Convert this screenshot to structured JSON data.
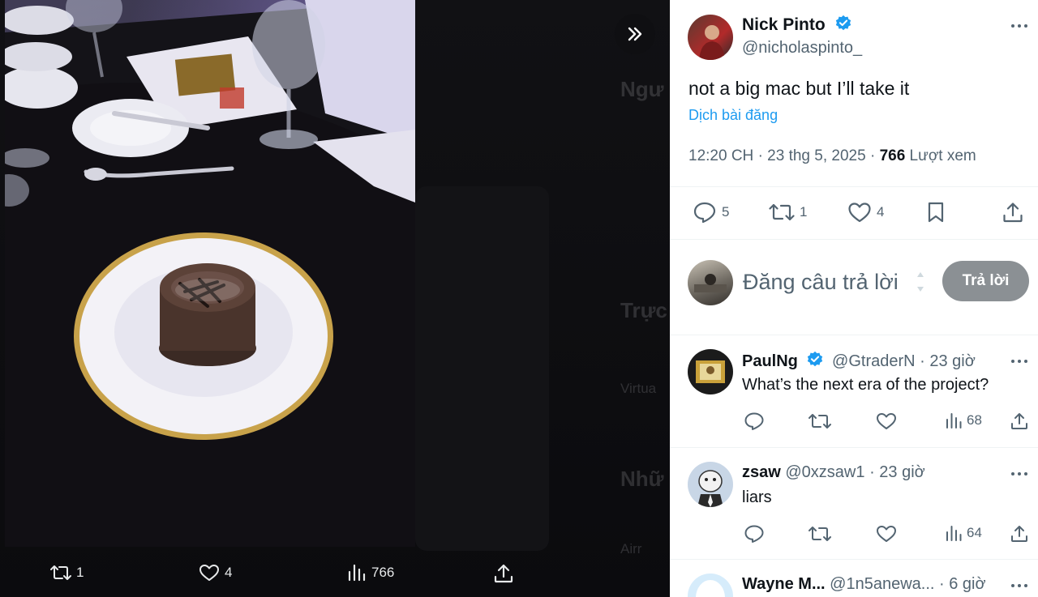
{
  "media": {
    "actions": [
      {
        "icon": "repost-icon",
        "count": "1"
      },
      {
        "icon": "heart-icon",
        "count": "4"
      },
      {
        "icon": "views-icon",
        "count": "766"
      },
      {
        "icon": "share-icon",
        "count": ""
      }
    ]
  },
  "tweet": {
    "name": "Nick Pinto",
    "handle": "@nicholaspinto_",
    "text": "not a big mac but I’ll take it",
    "translate": "Dịch bài đăng",
    "time": "12:20 CH",
    "date": "23 thg 5, 2025",
    "views_count": "766",
    "views_label": "Lượt xem",
    "replies": "5",
    "reposts": "1",
    "likes": "4"
  },
  "composer": {
    "placeholder": "Đăng câu trả lời",
    "button": "Trả lời"
  },
  "replies": [
    {
      "name": "PaulNg",
      "verified": true,
      "handle": "@GtraderN",
      "time": "23 giờ",
      "text": "What’s the next era of the project?",
      "views": "68"
    },
    {
      "name": "zsaw",
      "verified": false,
      "handle": "@0xzsaw1",
      "time": "23 giờ",
      "text": "liars",
      "views": "64"
    },
    {
      "name": "Wayne M...",
      "verified": false,
      "handle": "@1n5anewa...",
      "time": "6 giờ",
      "text": "",
      "views": ""
    }
  ],
  "colors": {
    "accent": "#1d9bf0",
    "text": "#0f1419",
    "muted": "#536471",
    "reply_button": "#8b9094"
  }
}
